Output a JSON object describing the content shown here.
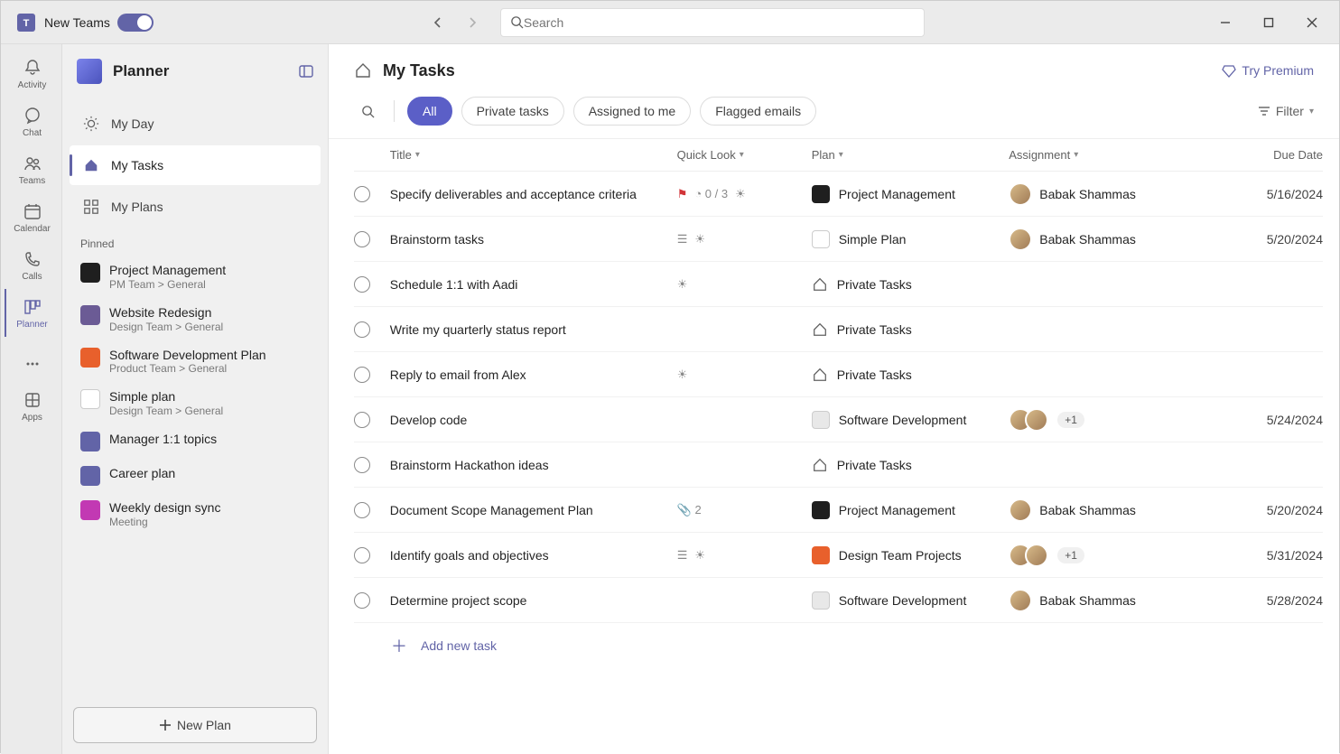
{
  "titlebar": {
    "app_label": "New Teams",
    "search_placeholder": "Search"
  },
  "rail": {
    "items": [
      {
        "label": "Activity",
        "icon": "bell"
      },
      {
        "label": "Chat",
        "icon": "chat"
      },
      {
        "label": "Teams",
        "icon": "people"
      },
      {
        "label": "Calendar",
        "icon": "calendar"
      },
      {
        "label": "Calls",
        "icon": "call"
      },
      {
        "label": "Planner",
        "icon": "board"
      },
      {
        "label": "",
        "icon": "more"
      },
      {
        "label": "Apps",
        "icon": "apps"
      }
    ],
    "active_index": 5
  },
  "sidebar": {
    "title": "Planner",
    "nav": [
      {
        "label": "My Day",
        "icon": "sun"
      },
      {
        "label": "My Tasks",
        "icon": "home"
      },
      {
        "label": "My Plans",
        "icon": "grid"
      }
    ],
    "nav_active_index": 1,
    "pinned_label": "Pinned",
    "pinned": [
      {
        "title": "Project Management",
        "sub": "PM Team > General",
        "color": "#1f1f1f"
      },
      {
        "title": "Website Redesign",
        "sub": "Design Team > General",
        "color": "#6b5b95"
      },
      {
        "title": "Software Development Plan",
        "sub": "Product Team > General",
        "color": "#e8602c"
      },
      {
        "title": "Simple plan",
        "sub": "Design Team > General",
        "color": "#ffffff"
      },
      {
        "title": "Manager 1:1 topics",
        "sub": "",
        "color": "#6264a7"
      },
      {
        "title": "Career plan",
        "sub": "",
        "color": "#6264a7"
      },
      {
        "title": "Weekly design sync",
        "sub": "Meeting",
        "color": "#c239b3"
      }
    ],
    "new_plan_label": "New Plan"
  },
  "content": {
    "title": "My Tasks",
    "premium_label": "Try Premium",
    "filter_label": "Filter",
    "chips": [
      {
        "label": "All",
        "active": true
      },
      {
        "label": "Private tasks",
        "active": false
      },
      {
        "label": "Assigned to me",
        "active": false
      },
      {
        "label": "Flagged emails",
        "active": false
      }
    ],
    "columns": {
      "title": "Title",
      "quick": "Quick Look",
      "plan": "Plan",
      "assignment": "Assignment",
      "due": "Due Date"
    },
    "rows": [
      {
        "title": "Specify deliverables and acceptance criteria",
        "quick": {
          "flag": true,
          "progress": "0 / 3",
          "category": true
        },
        "plan": {
          "name": "Project Management",
          "color": "#1f1f1f"
        },
        "assign": {
          "names": [
            "Babak Shammas"
          ],
          "extra": 0
        },
        "due": "5/16/2024"
      },
      {
        "title": "Brainstorm tasks",
        "quick": {
          "notes": true,
          "category": true
        },
        "plan": {
          "name": "Simple Plan",
          "color": "#ffffff"
        },
        "assign": {
          "names": [
            "Babak Shammas"
          ],
          "extra": 0
        },
        "due": "5/20/2024"
      },
      {
        "title": "Schedule 1:1 with Aadi",
        "quick": {
          "category": true
        },
        "plan": {
          "name": "Private Tasks",
          "private": true
        },
        "assign": {
          "names": [],
          "extra": 0
        },
        "due": ""
      },
      {
        "title": "Write my quarterly status report",
        "quick": {},
        "plan": {
          "name": "Private Tasks",
          "private": true
        },
        "assign": {
          "names": [],
          "extra": 0
        },
        "due": ""
      },
      {
        "title": "Reply to email from Alex",
        "quick": {
          "category": true
        },
        "plan": {
          "name": "Private Tasks",
          "private": true
        },
        "assign": {
          "names": [],
          "extra": 0
        },
        "due": ""
      },
      {
        "title": "Develop code",
        "quick": {},
        "plan": {
          "name": "Software Development",
          "color": "#e8e8e8"
        },
        "assign": {
          "names": [
            "A",
            "B"
          ],
          "extra": 1
        },
        "due": "5/24/2024"
      },
      {
        "title": "Brainstorm Hackathon ideas",
        "quick": {},
        "plan": {
          "name": "Private Tasks",
          "private": true
        },
        "assign": {
          "names": [],
          "extra": 0
        },
        "due": ""
      },
      {
        "title": "Document Scope Management Plan",
        "quick": {
          "attach": "2"
        },
        "plan": {
          "name": "Project Management",
          "color": "#1f1f1f"
        },
        "assign": {
          "names": [
            "Babak Shammas"
          ],
          "extra": 0
        },
        "due": "5/20/2024"
      },
      {
        "title": "Identify goals and objectives",
        "quick": {
          "notes": true,
          "category": true
        },
        "plan": {
          "name": "Design Team Projects",
          "color": "#e8602c"
        },
        "assign": {
          "names": [
            "A",
            "B"
          ],
          "extra": 1
        },
        "due": "5/31/2024"
      },
      {
        "title": "Determine project scope",
        "quick": {},
        "plan": {
          "name": "Software Development",
          "color": "#e8e8e8"
        },
        "assign": {
          "names": [
            "Babak Shammas"
          ],
          "extra": 0
        },
        "due": "5/28/2024"
      }
    ],
    "add_task_label": "Add new task"
  }
}
